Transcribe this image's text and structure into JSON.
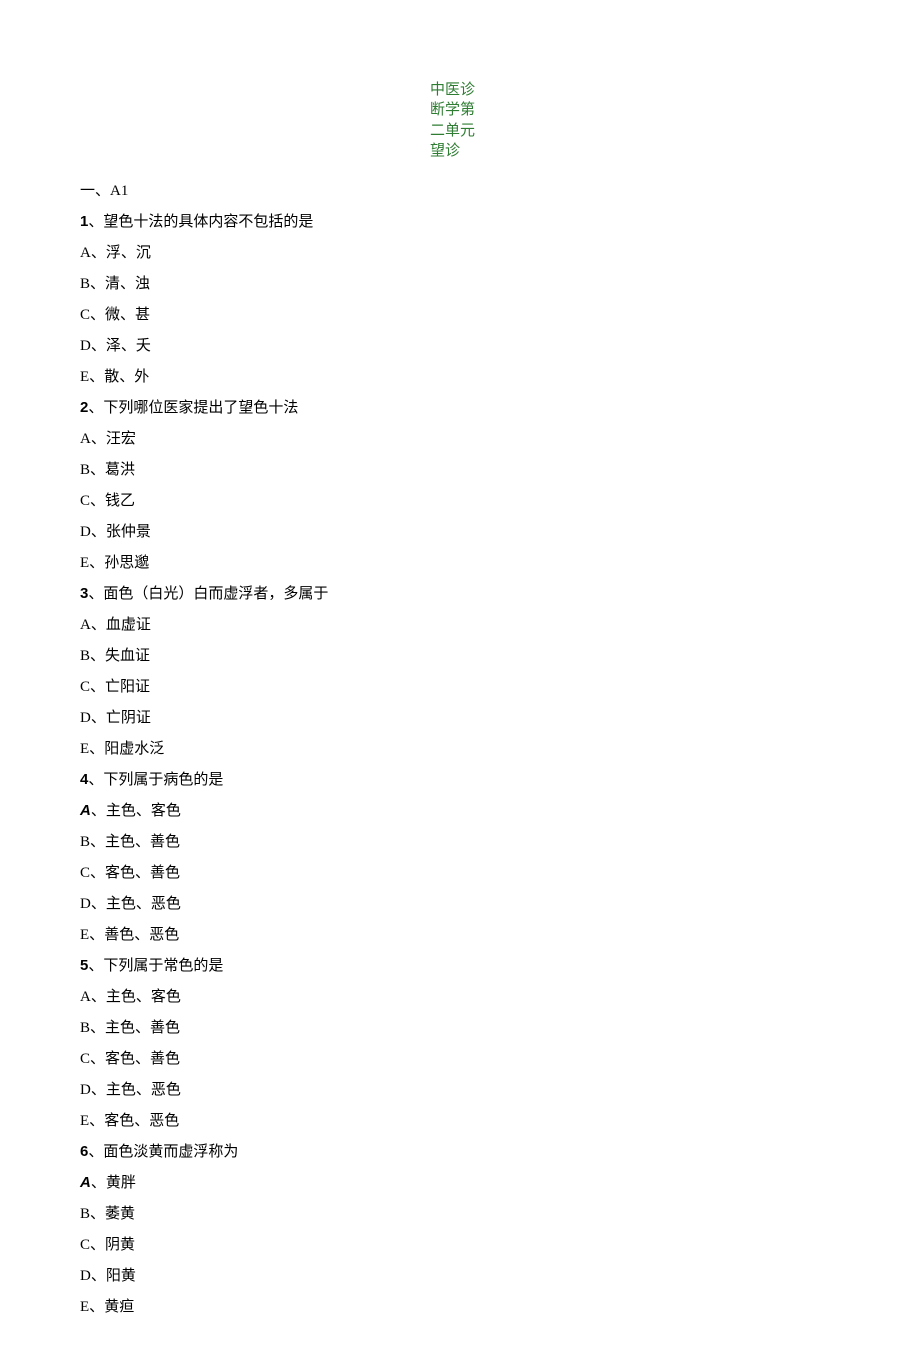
{
  "title_lines": [
    "中医诊",
    "断学第",
    "二单元",
    "望诊"
  ],
  "section_label": "一、A1",
  "questions": [
    {
      "num": "1",
      "stem": "望色十法的具体内容不包括的是",
      "options": [
        {
          "letter": "A",
          "text": "浮、沉",
          "sans": false
        },
        {
          "letter": "B",
          "text": "清、浊",
          "sans": false
        },
        {
          "letter": "C",
          "text": "微、甚",
          "sans": false
        },
        {
          "letter": "D",
          "text": "泽、夭",
          "sans": false
        },
        {
          "letter": "E",
          "text": "散、外",
          "sans": false
        }
      ]
    },
    {
      "num": "2",
      "stem": "下列哪位医家提出了望色十法",
      "options": [
        {
          "letter": "A",
          "text": "汪宏",
          "sans": false
        },
        {
          "letter": "B",
          "text": "葛洪",
          "sans": false
        },
        {
          "letter": "C",
          "text": "钱乙",
          "sans": false
        },
        {
          "letter": "D",
          "text": "张仲景",
          "sans": false
        },
        {
          "letter": "E",
          "text": "孙思邈",
          "sans": false
        }
      ]
    },
    {
      "num": "3",
      "stem": "面色（白光）白而虚浮者，多属于",
      "options": [
        {
          "letter": "A",
          "text": "血虚证",
          "sans": false
        },
        {
          "letter": "B",
          "text": "失血证",
          "sans": false
        },
        {
          "letter": "C",
          "text": "亡阳证",
          "sans": false
        },
        {
          "letter": "D",
          "text": "亡阴证",
          "sans": false
        },
        {
          "letter": "E",
          "text": "阳虚水泛",
          "sans": false
        }
      ]
    },
    {
      "num": "4",
      "stem": "下列属于病色的是",
      "options": [
        {
          "letter": "A",
          "text": "主色、客色",
          "sans": true
        },
        {
          "letter": "B",
          "text": "主色、善色",
          "sans": false
        },
        {
          "letter": "C",
          "text": "客色、善色",
          "sans": false
        },
        {
          "letter": "D",
          "text": "主色、恶色",
          "sans": false
        },
        {
          "letter": "E",
          "text": "善色、恶色",
          "sans": false
        }
      ]
    },
    {
      "num": "5",
      "stem": "下列属于常色的是",
      "options": [
        {
          "letter": "A",
          "text": "主色、客色",
          "sans": false
        },
        {
          "letter": "B",
          "text": "主色、善色",
          "sans": false
        },
        {
          "letter": "C",
          "text": "客色、善色",
          "sans": false
        },
        {
          "letter": "D",
          "text": "主色、恶色",
          "sans": false
        },
        {
          "letter": "E",
          "text": "客色、恶色",
          "sans": false
        }
      ]
    },
    {
      "num": "6",
      "stem": "面色淡黄而虚浮称为",
      "options": [
        {
          "letter": "A",
          "text": "黄胖",
          "sans": true
        },
        {
          "letter": "B",
          "text": "萎黄",
          "sans": false
        },
        {
          "letter": "C",
          "text": "阴黄",
          "sans": false
        },
        {
          "letter": "D",
          "text": "阳黄",
          "sans": false
        },
        {
          "letter": "E",
          "text": "黄疸",
          "sans": false
        }
      ]
    }
  ]
}
